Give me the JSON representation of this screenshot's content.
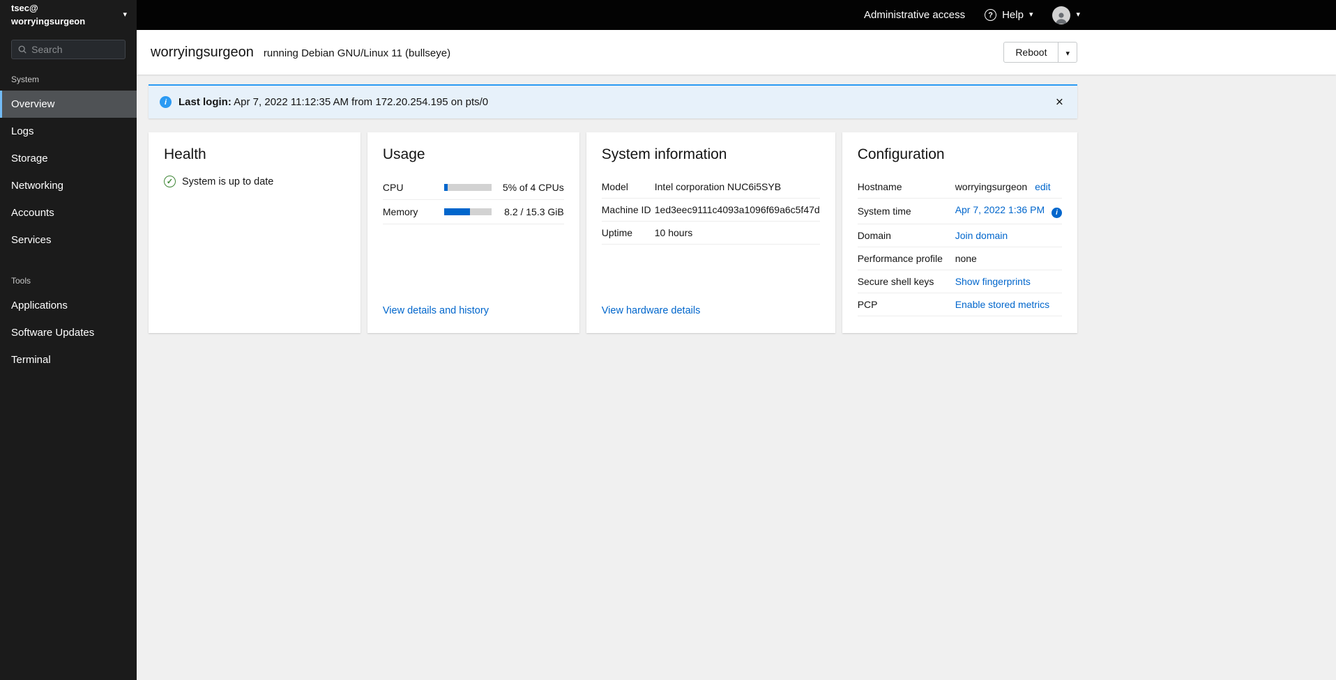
{
  "icons": {
    "caret_down": "▾",
    "close": "×",
    "check": "✓",
    "info": "i",
    "question": "?"
  },
  "masthead": {
    "user": "tsec@",
    "host": "worryingsurgeon",
    "admin_access": "Administrative access",
    "help": "Help"
  },
  "sidebar": {
    "search_placeholder": "Search",
    "section_system": "System",
    "section_tools": "Tools",
    "nav_system": [
      "Overview",
      "Logs",
      "Storage",
      "Networking",
      "Accounts",
      "Services"
    ],
    "nav_tools": [
      "Applications",
      "Software Updates",
      "Terminal"
    ]
  },
  "header": {
    "hostname": "worryingsurgeon",
    "os": "running Debian GNU/Linux 11 (bullseye)",
    "reboot": "Reboot"
  },
  "alert": {
    "title": "Last login:",
    "message": "Apr 7, 2022 11:12:35 AM from 172.20.254.195 on pts/0"
  },
  "cards": {
    "health": {
      "title": "Health",
      "status": "System is up to date"
    },
    "usage": {
      "title": "Usage",
      "rows": [
        {
          "label": "CPU",
          "value": "5% of 4 CPUs",
          "percent": 7
        },
        {
          "label": "Memory",
          "value": "8.2 / 15.3 GiB",
          "percent": 54
        }
      ],
      "link": "View details and history"
    },
    "system_info": {
      "title": "System information",
      "rows": [
        {
          "label": "Model",
          "value": "Intel corporation NUC6i5SYB"
        },
        {
          "label": "Machine ID",
          "value": "1ed3eec9111c4093a1096f69a6c5f47d"
        },
        {
          "label": "Uptime",
          "value": "10 hours"
        }
      ],
      "link": "View hardware details"
    },
    "configuration": {
      "title": "Configuration",
      "rows": [
        {
          "label": "Hostname",
          "value": "worryingsurgeon",
          "link": "edit"
        },
        {
          "label": "System time",
          "link": "Apr 7, 2022 1:36 PM"
        },
        {
          "label": "Domain",
          "link": "Join domain"
        },
        {
          "label": "Performance profile",
          "value": "none"
        },
        {
          "label": "Secure shell keys",
          "link": "Show fingerprints"
        },
        {
          "label": "PCP",
          "link": "Enable stored metrics"
        }
      ]
    }
  }
}
